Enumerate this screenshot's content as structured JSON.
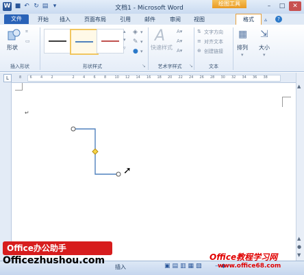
{
  "app": {
    "title": "文档1 - Microsoft Word",
    "contextual_tab": "绘图工具",
    "icon_letter": "W"
  },
  "quick_access": [
    "save-icon",
    "undo-icon",
    "redo-icon",
    "open-icon"
  ],
  "window_controls": [
    "minimize",
    "maximize",
    "close"
  ],
  "tabs": [
    {
      "label": "文件"
    },
    {
      "label": "开始"
    },
    {
      "label": "插入"
    },
    {
      "label": "页面布局"
    },
    {
      "label": "引用"
    },
    {
      "label": "邮件"
    },
    {
      "label": "审阅"
    },
    {
      "label": "视图"
    },
    {
      "label": "格式"
    }
  ],
  "ribbon": {
    "insert_shapes": {
      "shape_label": "形状",
      "group_label": "插入形状"
    },
    "shape_styles": {
      "group_label": "形状样式",
      "line_colors": [
        "#3c3c3c",
        "#4f81bd",
        "#c0504d"
      ]
    },
    "wordart": {
      "quick_styles_label": "快速样式",
      "group_label": "艺术字样式"
    },
    "text": {
      "direction": "文字方向",
      "align": "对齐文本",
      "link": "创建链接",
      "group_label": "文本"
    },
    "arrange_label": "排列",
    "size_label": "大小"
  },
  "ruler": {
    "ticks": [
      "8",
      "6",
      "4",
      "2",
      "",
      "2",
      "4",
      "6",
      "8",
      "10",
      "12",
      "14",
      "16",
      "18",
      "20",
      "22",
      "24",
      "26",
      "28",
      "30",
      "32",
      "34",
      "36",
      "38"
    ]
  },
  "status": {
    "right_label": "插入"
  },
  "watermarks": {
    "badge": "Office办公助手",
    "site1": "Officezhushou.com",
    "site2": "Office教程学习网",
    "site2_url": "www.office68.com"
  },
  "colors": {
    "accent": "#2b579a",
    "connector": "#4f81bd",
    "contextual": "#f0a830"
  }
}
